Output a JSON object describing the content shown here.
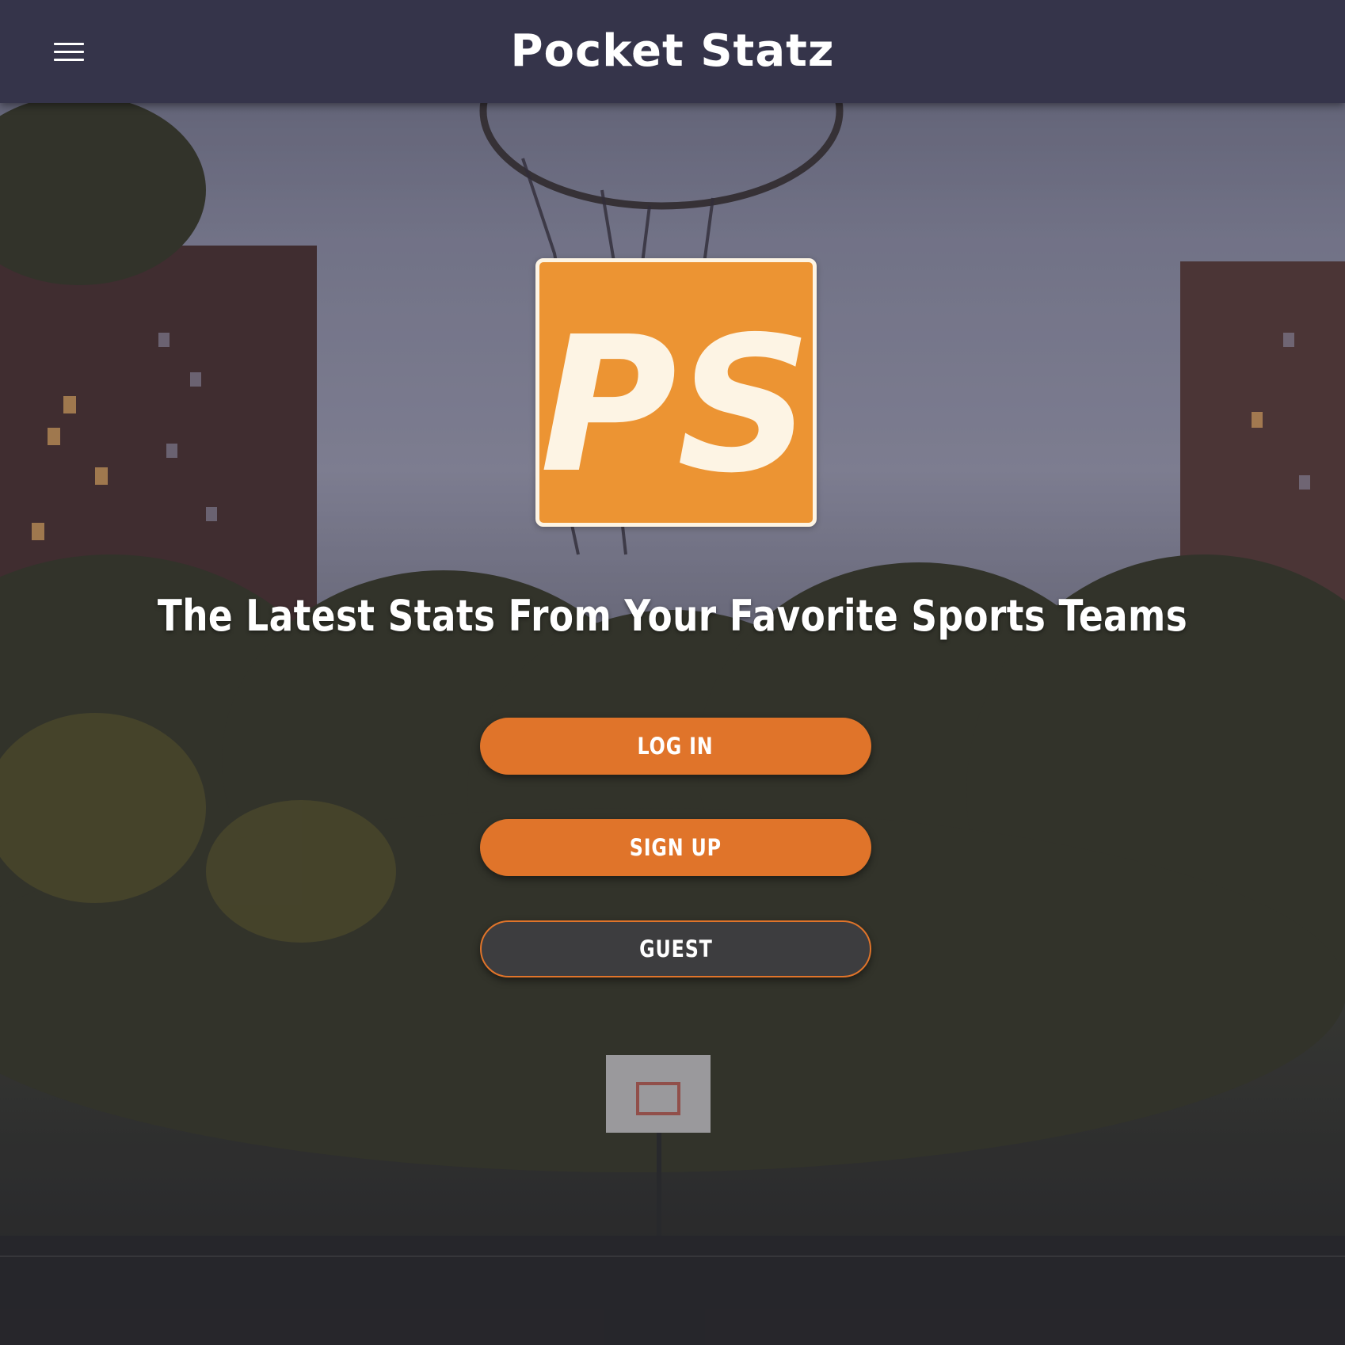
{
  "header": {
    "app_title": "Pocket Statz",
    "menu_icon": "hamburger-menu-icon"
  },
  "hero": {
    "logo_text": "PS",
    "tagline": "The Latest Stats From Your Favorite Sports Teams"
  },
  "actions": {
    "login_label": "LOG IN",
    "signup_label": "SIGN UP",
    "guest_label": "GUEST"
  },
  "colors": {
    "header_bg": "#35344a",
    "accent": "#e0742a",
    "logo_bg": "#ec9433",
    "logo_text": "#fdf4e4",
    "guest_bg": "#3d3d3f"
  }
}
